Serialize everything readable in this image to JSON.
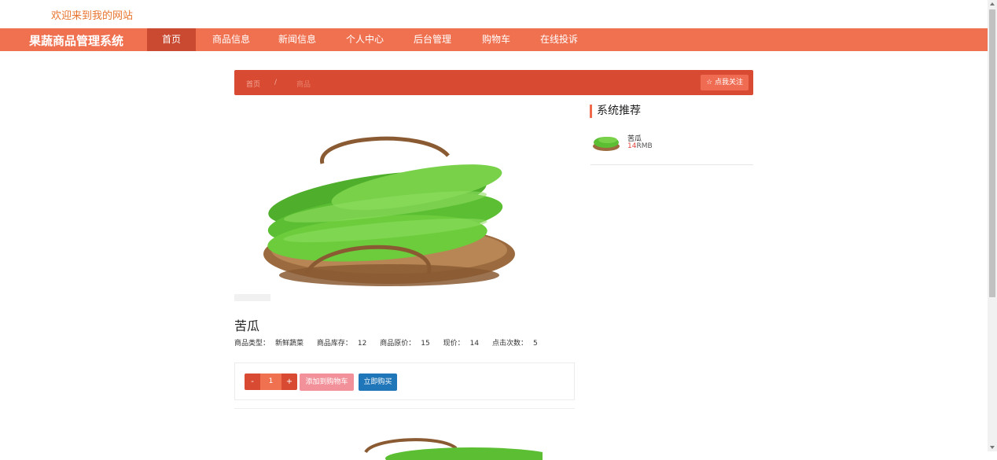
{
  "header": {
    "welcome": "欢迎来到我的网站"
  },
  "navbar": {
    "brand": "果蔬商品管理系统",
    "items": [
      {
        "label": "首页",
        "active": true
      },
      {
        "label": "商品信息"
      },
      {
        "label": "新闻信息"
      },
      {
        "label": "个人中心"
      },
      {
        "label": "后台管理"
      },
      {
        "label": "购物车"
      },
      {
        "label": "在线投诉"
      }
    ]
  },
  "breadcrumb": {
    "home": "首页",
    "separator": "/",
    "current": "商品",
    "follow_label": "☆ 点我关注"
  },
  "product": {
    "name": "苦瓜",
    "specs": [
      {
        "label": "商品类型：",
        "value": "新鲜蔬菜"
      },
      {
        "label": "商品库存：",
        "value": "12"
      },
      {
        "label": "商品原价：",
        "value": "15"
      },
      {
        "label": "现价：",
        "value": "14"
      },
      {
        "label": "点击次数：",
        "value": "5"
      }
    ],
    "quantity": {
      "minus": "-",
      "value": "1",
      "plus": "+"
    },
    "add_to_cart": "添加到购物车",
    "buy_now": "立即购买"
  },
  "sidebar": {
    "title": "系统推荐",
    "items": [
      {
        "name": "苦瓜",
        "price": "14",
        "unit": "RMB"
      }
    ]
  },
  "colors": {
    "nav": "#f07150",
    "nav_active": "#c94a30",
    "breadcrumb": "#d84a32",
    "buy": "#1f76b8",
    "cart": "#f2919a"
  }
}
